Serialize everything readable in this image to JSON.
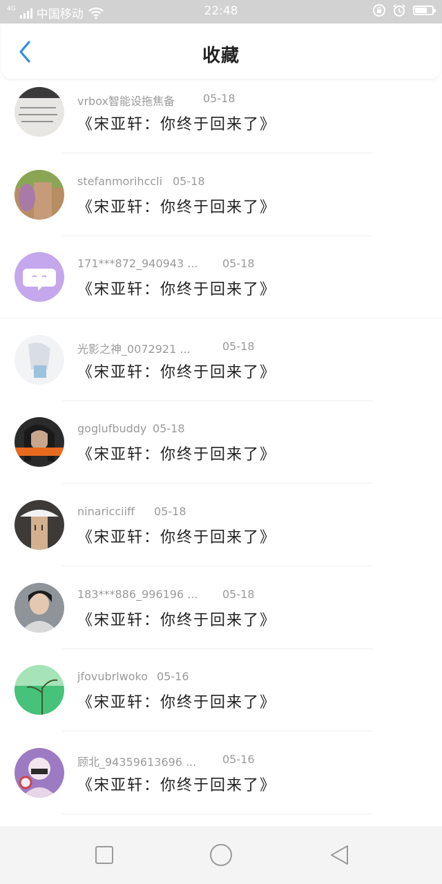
{
  "status_bar": {
    "network": "4G",
    "carrier": "中国移动",
    "time": "22:48",
    "icons": [
      "signal-icon",
      "wifi-icon",
      "rotation-lock-icon",
      "alarm-icon",
      "battery-icon"
    ],
    "battery_level": 0.7
  },
  "header": {
    "title": "收藏",
    "back_icon": "chevron-left-icon",
    "accent_color": "#2b8de8"
  },
  "items": [
    {
      "user": "vrbox智能设拖焦备",
      "date": "05-18",
      "title": "《宋亚轩：你终于回来了》"
    },
    {
      "user": "stefanmorihccli",
      "date": "05-18",
      "title": "《宋亚轩：你终于回来了》"
    },
    {
      "user": "171***872_940943 ...",
      "date": "05-18",
      "title": "《宋亚轩：你终于回来了》"
    },
    {
      "user": "光影之神_0072921 ...",
      "date": "05-18",
      "title": "《宋亚轩：你终于回来了》"
    },
    {
      "user": "goglufbuddy",
      "date": "05-18",
      "title": "《宋亚轩：你终于回来了》"
    },
    {
      "user": "ninaricciiff",
      "date": "05-18",
      "title": "《宋亚轩：你终于回来了》"
    },
    {
      "user": "183***886_996196 ...",
      "date": "05-18",
      "title": "《宋亚轩：你终于回来了》"
    },
    {
      "user": "jfovubrlwoko",
      "date": "05-16",
      "title": "《宋亚轩：你终于回来了》"
    },
    {
      "user": "顾北_94359613696 ...",
      "date": "05-16",
      "title": "《宋亚轩：你终于回来了》"
    }
  ],
  "nav_bar": {
    "icons": [
      "recent-apps-icon",
      "home-icon",
      "back-icon"
    ]
  }
}
